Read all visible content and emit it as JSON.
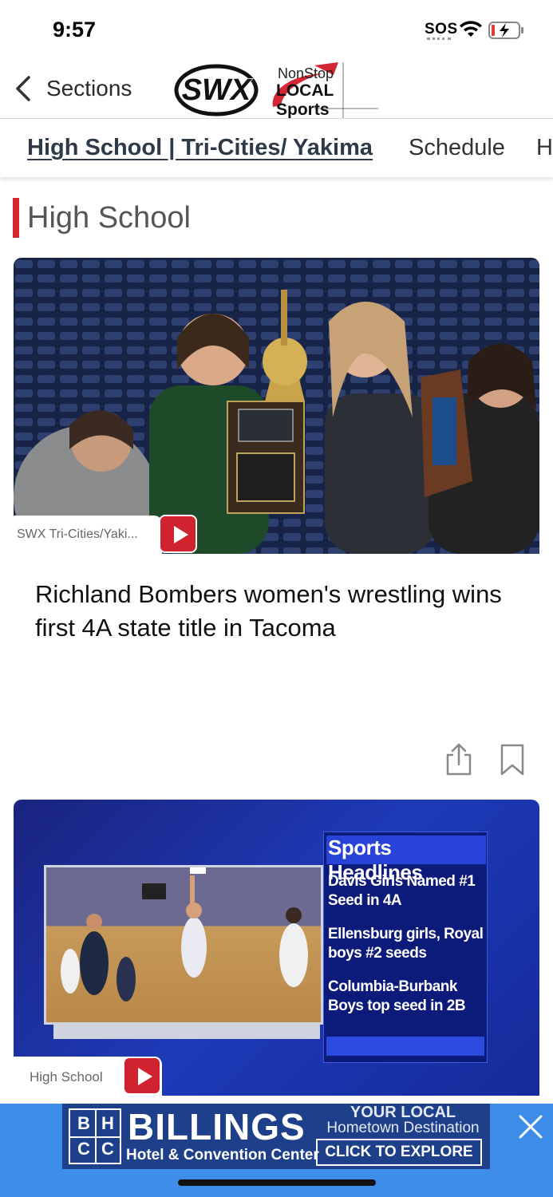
{
  "status_bar": {
    "time": "9:57",
    "sos": "SOS"
  },
  "header": {
    "back_label": "Sections",
    "logo_swx": "SWX",
    "logo_nonstop_line1": "NonStop",
    "logo_nonstop_line2": "LOCAL Sports"
  },
  "tabs": [
    {
      "label": "High School | Tri-Cities/ Yakima",
      "active": true
    },
    {
      "label": "Schedule"
    },
    {
      "label": "H"
    }
  ],
  "section": {
    "title": "High School"
  },
  "articles": [
    {
      "source_tag": "SWX Tri-Cities/Yaki...",
      "title": "Richland Bombers women's wrestling wins first 4A state title in Tacoma"
    },
    {
      "source_tag": "High School",
      "graphic": {
        "title": "Sports Headlines",
        "items": [
          "Davis Girls Named #1 Seed in 4A",
          "Ellensburg girls, Royal boys #2 seeds",
          "Columbia-Burbank Boys top seed in 2B"
        ]
      }
    }
  ],
  "ad": {
    "logo_letters": [
      "B",
      "H",
      "C",
      "C"
    ],
    "name": "BILLINGS",
    "subtitle": "Hotel & Convention Center",
    "tagline_1": "YOUR LOCAL",
    "tagline_2": "Hometown Destination",
    "cta": "CLICK TO EXPLORE"
  },
  "colors": {
    "accent_red": "#d32733",
    "ad_blue": "#3e8de8",
    "ad_navy": "#1e3f8a"
  }
}
